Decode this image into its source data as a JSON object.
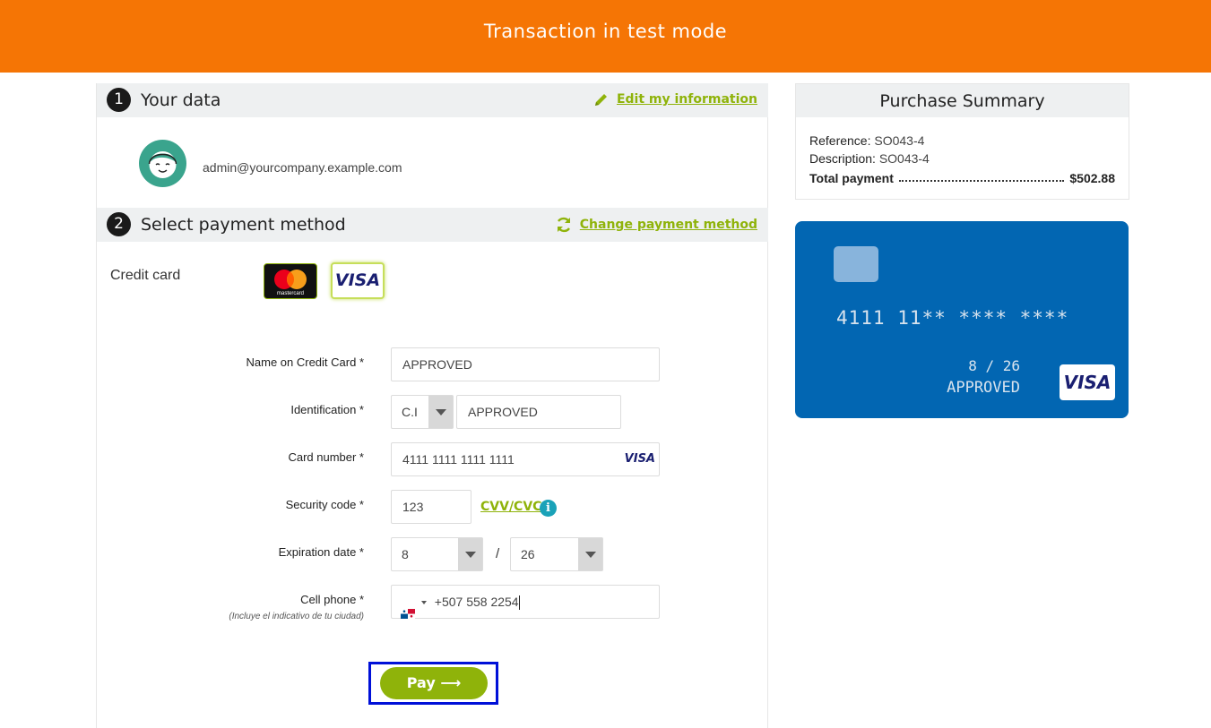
{
  "banner": {
    "text": "Transaction in test mode"
  },
  "steps": {
    "data": {
      "number": "1",
      "title": "Your data",
      "link": "Edit my information"
    },
    "payment": {
      "number": "2",
      "title": "Select payment method",
      "link": "Change payment method"
    }
  },
  "user": {
    "email": "admin@yourcompany.example.com"
  },
  "payment": {
    "method_label": "Credit card",
    "brands": [
      "mastercard",
      "VISA"
    ],
    "selected_brand": "VISA"
  },
  "form": {
    "name": {
      "label": "Name on Credit Card *",
      "value": "APPROVED"
    },
    "identification": {
      "label": "Identification *",
      "type": "C.I",
      "value": "APPROVED"
    },
    "card_number": {
      "label": "Card number *",
      "value": "4111 1111 1111 1111",
      "brand": "VISA"
    },
    "security_code": {
      "label": "Security code *",
      "value": "123",
      "link": "CVV/CVC"
    },
    "expiration": {
      "label": "Expiration date *",
      "month": "8",
      "separator": "/",
      "year": "26"
    },
    "phone": {
      "label": "Cell phone *",
      "sublabel": "(Incluye el indicativo de tu ciudad)",
      "value": "+507 558 2254"
    },
    "pay_button": "Pay ⟶"
  },
  "summary": {
    "title": "Purchase Summary",
    "reference_label": "Reference:",
    "reference": "SO043-4",
    "description_label": "Description:",
    "description": "SO043-4",
    "total_label": "Total payment",
    "total": "$502.88"
  },
  "card_preview": {
    "number": "4111 11** **** ****",
    "expiry": "8 / 26",
    "holder": "APPROVED",
    "brand": "VISA"
  },
  "colors": {
    "banner": "#f57505",
    "accent": "#8fb30a",
    "card": "#0266b2",
    "highlight": "#0010d8"
  }
}
